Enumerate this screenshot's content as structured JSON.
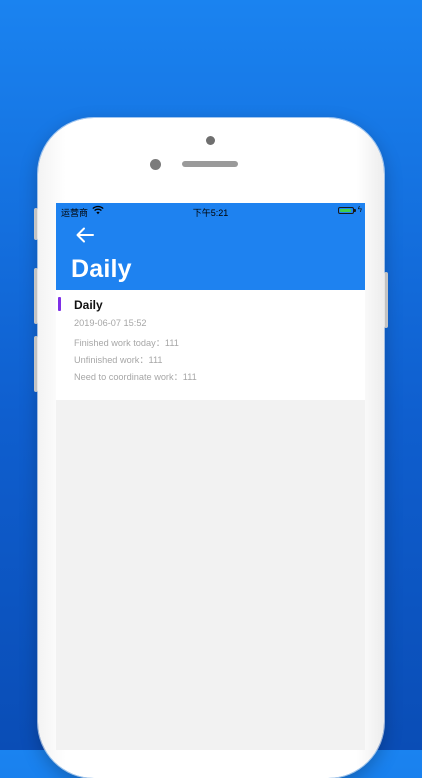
{
  "status_bar": {
    "carrier": "运营商",
    "time": "下午5:21",
    "battery_level": 0.9
  },
  "header": {
    "title": "Daily",
    "back_icon": "arrow-left-icon"
  },
  "report": {
    "title": "Daily",
    "date": "2019-06-07 15:52",
    "finished": "Finished work today：111",
    "unfinished": "Unfinished work：111",
    "coordinate": "Need to coordinate work：111"
  },
  "colors": {
    "background_top": "#1a83f0",
    "background_bottom": "#0a4db6",
    "header": "#1e82f0",
    "accent": "#7e2fe6",
    "battery": "#3ecf4a"
  }
}
